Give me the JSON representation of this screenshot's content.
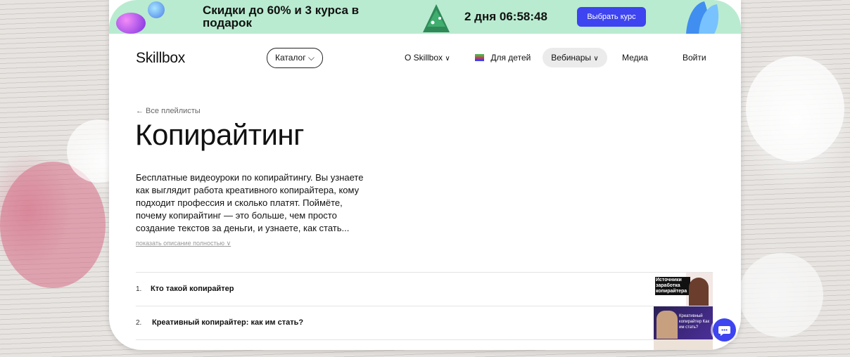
{
  "promo": {
    "text": "Скидки до 60% и 3 курса в подарок",
    "timer": "2 дня 06:58:48",
    "button": "Выбрать курс"
  },
  "nav": {
    "logo": "Skillbox",
    "catalog": "Каталог",
    "about": "О Skillbox",
    "kids": "Для детей",
    "webinars": "Вебинары",
    "media": "Медиа",
    "login": "Войти"
  },
  "page": {
    "back": "← Все плейлисты",
    "title": "Копирайтинг",
    "description": "Бесплатные видеоуроки по копирайтингу. Вы узнаете как выглядит работа креативного копирайтера, кому подходит профессия и сколько платят. Поймёте, почему копирайтинг — это больше, чем просто создание текстов за деньги, и узнаете, как стать...",
    "show_more": "показать описание полностью"
  },
  "playlist": [
    {
      "num": "1.",
      "title": "Кто такой копирайтер",
      "thumb_text": "Источники заработка копирайтера"
    },
    {
      "num": "2.",
      "title": "Креативный копирайтер: как им стать?",
      "thumb_text": "Креативный копирайтер Как им стать?"
    }
  ],
  "colors": {
    "accent": "#3e44f0",
    "promo_bg": "#b9ebd0"
  },
  "icons": {
    "chevron": "chevron-down-icon",
    "chat": "chat-icon"
  }
}
